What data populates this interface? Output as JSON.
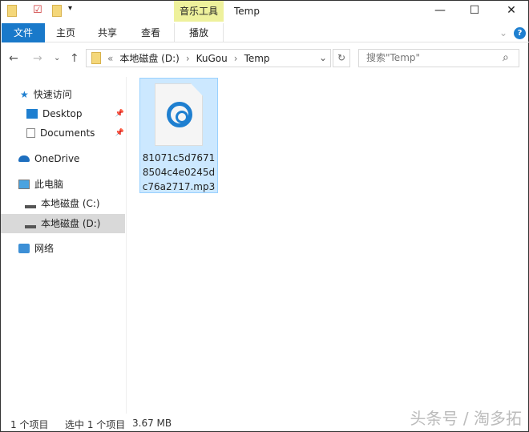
{
  "window": {
    "title": "Temp",
    "tool_tab": "音乐工具",
    "minimize": "—",
    "maximize": "☐",
    "close": "✕"
  },
  "ribbon": {
    "tabs": [
      "文件",
      "主页",
      "共享",
      "查看"
    ],
    "context_tab": "播放",
    "collapse": "⌄",
    "help": "?"
  },
  "address": {
    "overflow": "«",
    "parts": [
      "本地磁盘 (D:)",
      "KuGou",
      "Temp"
    ],
    "sep": "›",
    "dropdown": "⌄",
    "refresh": "↻"
  },
  "nav": {
    "back": "←",
    "forward": "→",
    "recent": "⌄",
    "up": "↑"
  },
  "search": {
    "placeholder": "搜索\"Temp\"",
    "icon": "⌕"
  },
  "sidebar": {
    "items": [
      {
        "label": "快速访问"
      },
      {
        "label": "Desktop"
      },
      {
        "label": "Documents"
      },
      {
        "label": "OneDrive"
      },
      {
        "label": "此电脑"
      },
      {
        "label": "本地磁盘 (C:)"
      },
      {
        "label": "本地磁盘 (D:)"
      },
      {
        "label": "网络"
      }
    ],
    "pin": "📌"
  },
  "file": {
    "name": "81071c5d76718504c4e0245dc76a2717.mp3"
  },
  "status": {
    "count": "1 个项目",
    "selected": "选中 1 个项目",
    "size": "3.67 MB"
  },
  "watermark": "头条号 / 淘多拓"
}
